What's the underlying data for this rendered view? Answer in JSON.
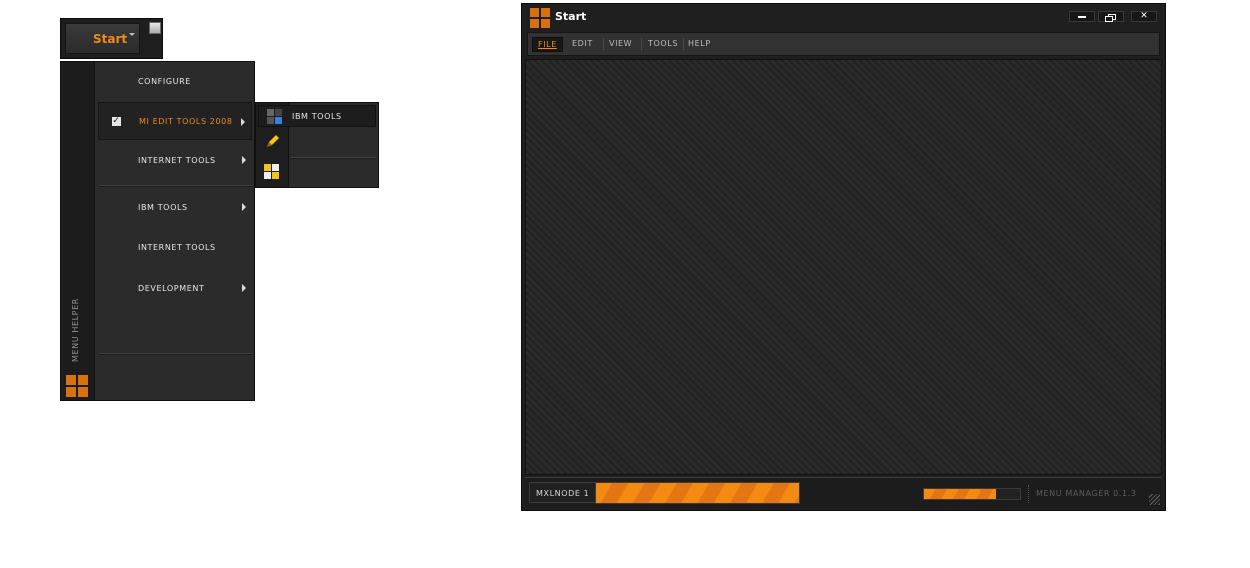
{
  "start_widget": {
    "label": "Start"
  },
  "menu_helper": {
    "side_label": "Menu Helper",
    "items": [
      {
        "label": "Configure",
        "submenu": false,
        "checked": false,
        "active": false
      },
      {
        "label": "MI Edit Tools 2008",
        "submenu": true,
        "checked": true,
        "active": true
      },
      {
        "label": "Internet Tools",
        "submenu": true,
        "checked": false,
        "active": false
      },
      {
        "label": "IBM Tools",
        "submenu": true,
        "checked": false,
        "active": false
      },
      {
        "label": "Internet Tools",
        "submenu": false,
        "checked": false,
        "active": false
      },
      {
        "label": "Development",
        "submenu": true,
        "checked": false,
        "active": false
      }
    ]
  },
  "submenu": {
    "items": [
      {
        "label": "IBM Tools",
        "icon": "ibm-tools-icon"
      },
      {
        "label": "",
        "icon": "pencil-icon"
      },
      {
        "label": "",
        "icon": "grid-icon"
      }
    ]
  },
  "window": {
    "title": "Start",
    "menubar": [
      "File",
      "Edit",
      "View",
      "Tools",
      "Help"
    ]
  },
  "statusbar": {
    "node_label": "MXLNODE 1",
    "main_progress": 1.0,
    "small_progress": 0.75,
    "version": "MENU MANAGER 0.1.3"
  },
  "colors": {
    "accent": "#f08a1c",
    "background": "#1f1f1f"
  }
}
